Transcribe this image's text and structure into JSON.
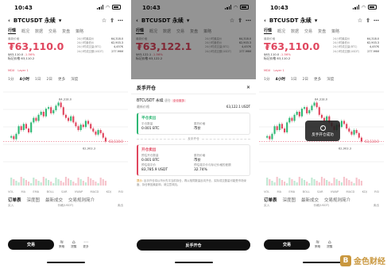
{
  "status": {
    "time": "10:43"
  },
  "header": {
    "symbol": "BTCUSDT 永续",
    "caret": "▾"
  },
  "tabs": [
    "行情",
    "概况",
    "数据",
    "交易",
    "复盘",
    "策略"
  ],
  "price": {
    "label": "最新价格",
    "value_a": "₮63,110.0",
    "value_b": "₮63,122.1",
    "sub_a": "$63,110.0",
    "sub_b": "$63,122.1",
    "change": "-1.56%",
    "mark_label": "标记价格",
    "mark_a": "63,110.2",
    "mark_b": "63,122.2",
    "tag1": "MDX",
    "tag2": "Layer 1",
    "stats": [
      {
        "k": "24小时最高价",
        "v": "64,318.0"
      },
      {
        "k": "24小时最低价",
        "v": "62,903.3"
      },
      {
        "k": "24小时成交量(BTC)",
        "v": "4,457K"
      },
      {
        "k": "24小时成交额(USDT)",
        "v": "277.99M"
      }
    ]
  },
  "intervals": [
    "1分",
    "4小时",
    "1日",
    "2日",
    "更多",
    "深度"
  ],
  "chart": {
    "label_low": "62,903.3",
    "label_price": "63,110.0",
    "label_high": "64,318.0"
  },
  "indicators": [
    "VOL",
    "MA",
    "EMA",
    "BOLL",
    "SAR",
    "VWAP",
    "MACD",
    "KDJ",
    "RSI"
  ],
  "bottom_tabs": [
    "订单表",
    "深度图",
    "最新成交",
    "交易规则简介"
  ],
  "bottom_sub": {
    "left": "买入",
    "mid": "价格(USDT)",
    "right": "卖出"
  },
  "bottom_bar": {
    "trade": "交易",
    "icons": [
      {
        "icon": "≋",
        "label": "策略"
      },
      {
        "icon": "⌂",
        "label": "提醒"
      },
      {
        "icon": "⋯",
        "label": "更多"
      }
    ]
  },
  "sheet": {
    "title": "反手开仓",
    "close": "✕",
    "pos_name": "BTCUSDT 永续",
    "pos_mode": "逐仓",
    "pos_tag": "全仓做多",
    "last_label": "最新价格",
    "last_value": "63,122.1 USDT",
    "close_card": {
      "title": "平仓卖出",
      "l1": "平仓数量",
      "v1": "0.001 BTC",
      "l2": "委托价格",
      "v2": "市价"
    },
    "sep": "反手开仓",
    "open_card": {
      "title": "开仓卖出",
      "l1": "预估开仓数量",
      "v1": "0.001 BTC",
      "l2": "委托价格",
      "v2": "市价",
      "l3": "预估强平价",
      "v3": "83,785.9 USDT",
      "l4": "预估强平价与标记价格的差额",
      "v4": "32.74%"
    },
    "note_prefix": "提示",
    "note": "反手开仓将以市价先平当前持仓，再以相同数量反向开仓，实际成交数量可能受市场深度、持仓等因素影响，请注意风险。",
    "confirm": "反手开仓"
  },
  "toast": {
    "icon": "✓",
    "text": "反手开仓成功"
  },
  "watermark": {
    "logo": "B",
    "text": "金色财经"
  }
}
